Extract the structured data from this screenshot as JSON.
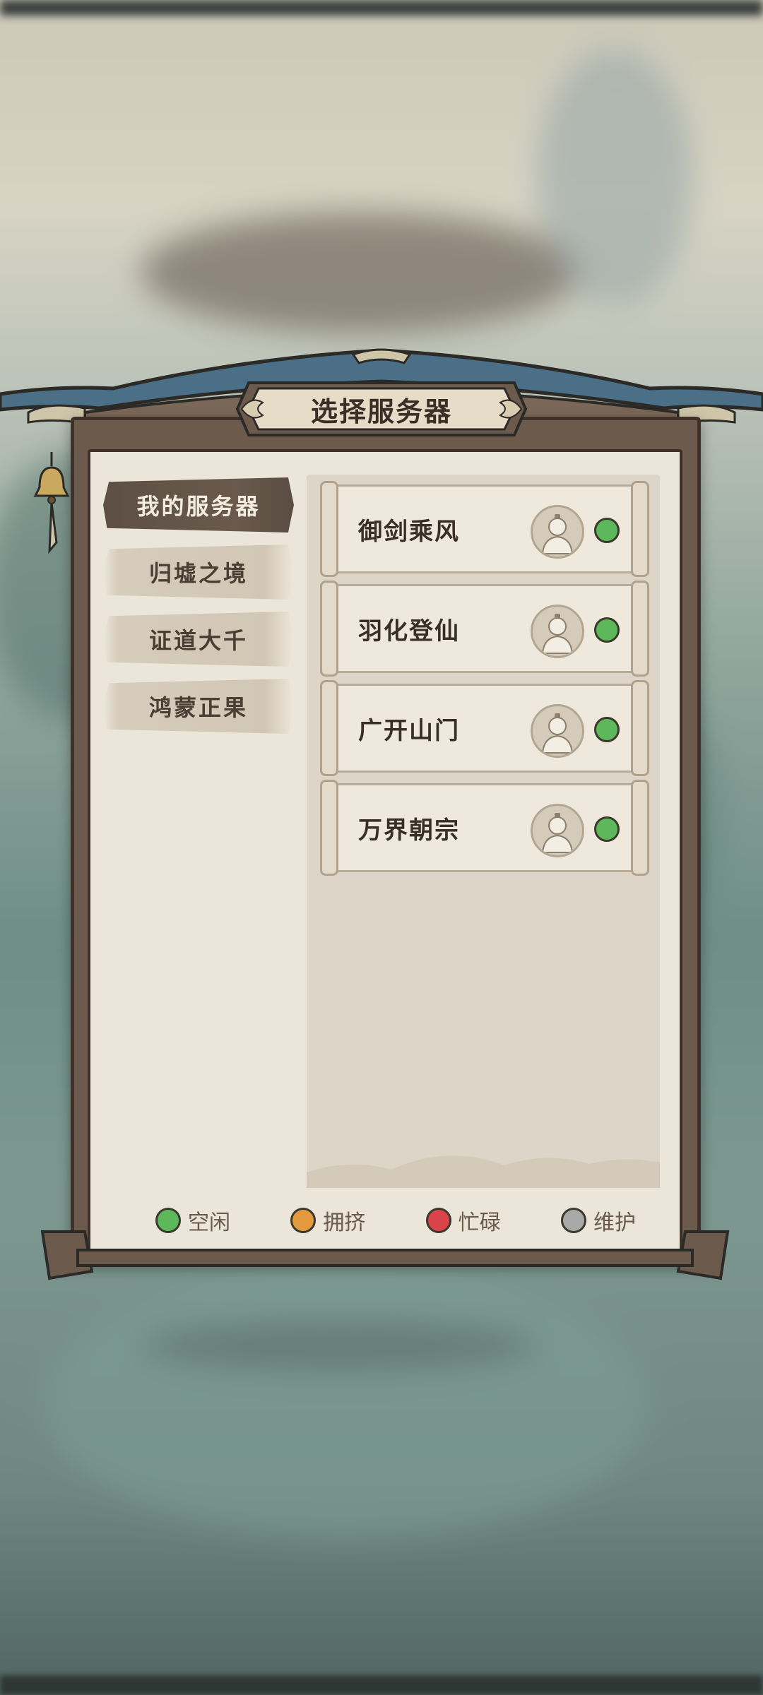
{
  "dialog": {
    "title": "选择服务器"
  },
  "tabs": [
    {
      "label": "我的服务器",
      "active": true
    },
    {
      "label": "归墟之境",
      "active": false
    },
    {
      "label": "证道大千",
      "active": false
    },
    {
      "label": "鸿蒙正果",
      "active": false
    }
  ],
  "servers": [
    {
      "name": "御剑乘风",
      "status": "空闲",
      "status_color": "#5cb85a",
      "avatar_icon": "player-avatar-icon"
    },
    {
      "name": "羽化登仙",
      "status": "空闲",
      "status_color": "#5cb85a",
      "avatar_icon": "player-avatar-icon"
    },
    {
      "name": "广开山门",
      "status": "空闲",
      "status_color": "#5cb85a",
      "avatar_icon": "player-avatar-icon"
    },
    {
      "name": "万界朝宗",
      "status": "空闲",
      "status_color": "#5cb85a",
      "avatar_icon": "player-avatar-icon"
    }
  ],
  "legend": [
    {
      "label": "空闲",
      "color": "#5cb85a"
    },
    {
      "label": "拥挤",
      "color": "#e39a3e"
    },
    {
      "label": "忙碌",
      "color": "#d9434a"
    },
    {
      "label": "维护",
      "color": "#a7a9a6"
    }
  ],
  "colors": {
    "panel": "#ece6da",
    "frame": "#6c5b4c",
    "roof_tile": "#4a6f86",
    "text": "#3a2f27"
  }
}
